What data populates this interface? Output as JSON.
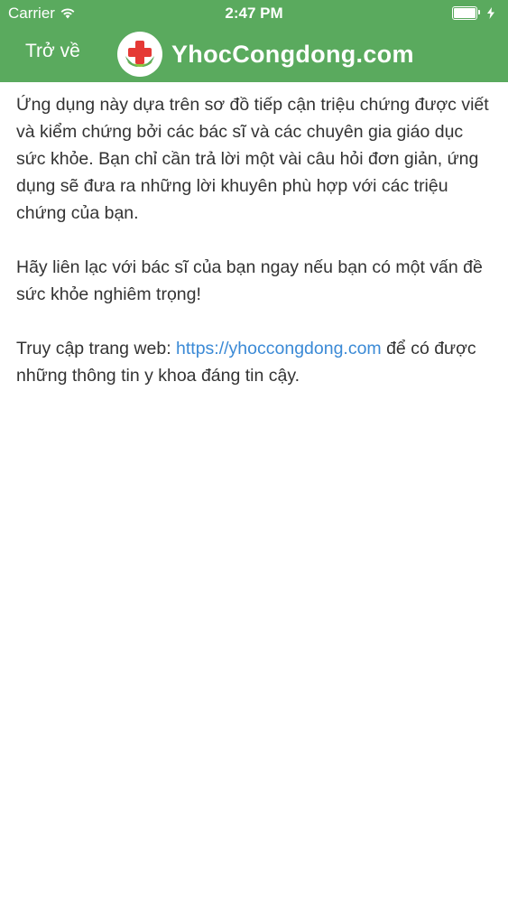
{
  "status_bar": {
    "carrier": "Carrier",
    "time": "2:47 PM",
    "icons": [
      "wifi-icon",
      "battery-icon",
      "charging-icon"
    ]
  },
  "nav": {
    "back_label": "Trở về",
    "brand": "YhocCongdong.com",
    "logo_icon": "red-cross-icon"
  },
  "colors": {
    "header_bg": "#5aaa5e",
    "link": "#3b8ad6",
    "logo_cross": "#e53935"
  },
  "content": {
    "paragraph1": "Ứng dụng này dựa trên sơ đồ tiếp cận triệu chứng được viết và kiểm chứng bởi các bác sĩ và các chuyên gia giáo dục sức khỏe. Bạn chỉ cần trả lời một vài câu hỏi đơn giản, ứng dụng sẽ đưa ra những lời khuyên phù hợp với các triệu chứng của bạn.",
    "paragraph2": "Hãy liên lạc với bác sĩ của bạn ngay nếu bạn có một vấn đề sức khỏe nghiêm trọng!",
    "paragraph3_before": "Truy cập trang web: ",
    "paragraph3_link": "https://yhoccongdong.com",
    "paragraph3_after": " để có được những thông tin y khoa đáng tin cậy."
  }
}
